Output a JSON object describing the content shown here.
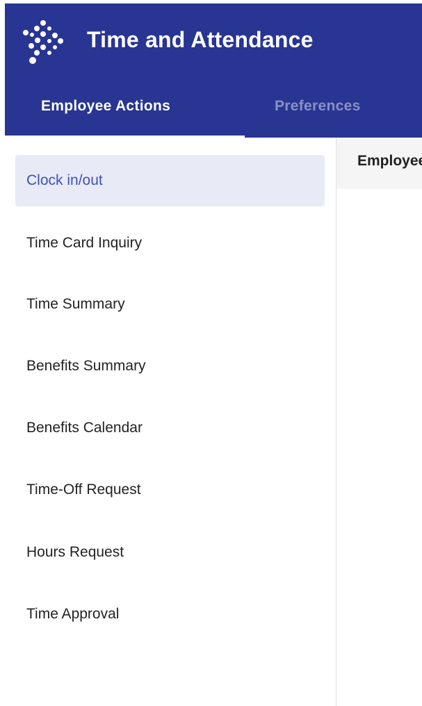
{
  "app": {
    "title": "Time and Attendance",
    "logo_icon": "dotted-diamond-logo-icon"
  },
  "tabs": [
    {
      "label": "Employee Actions",
      "active": true
    },
    {
      "label": "Preferences",
      "active": false
    }
  ],
  "sidebar": {
    "items": [
      {
        "label": "Clock in/out",
        "active": true
      },
      {
        "label": "Time Card Inquiry"
      },
      {
        "label": "Time Summary"
      },
      {
        "label": "Benefits Summary"
      },
      {
        "label": "Benefits Calendar"
      },
      {
        "label": "Time-Off Request"
      },
      {
        "label": "Hours Request"
      },
      {
        "label": "Time Approval"
      }
    ]
  },
  "main": {
    "header_title": "Employee"
  },
  "colors": {
    "header_bg": "#283593",
    "active_item_bg": "#e8eaf6",
    "active_item_text": "#3f51b5",
    "text": "#222222"
  }
}
